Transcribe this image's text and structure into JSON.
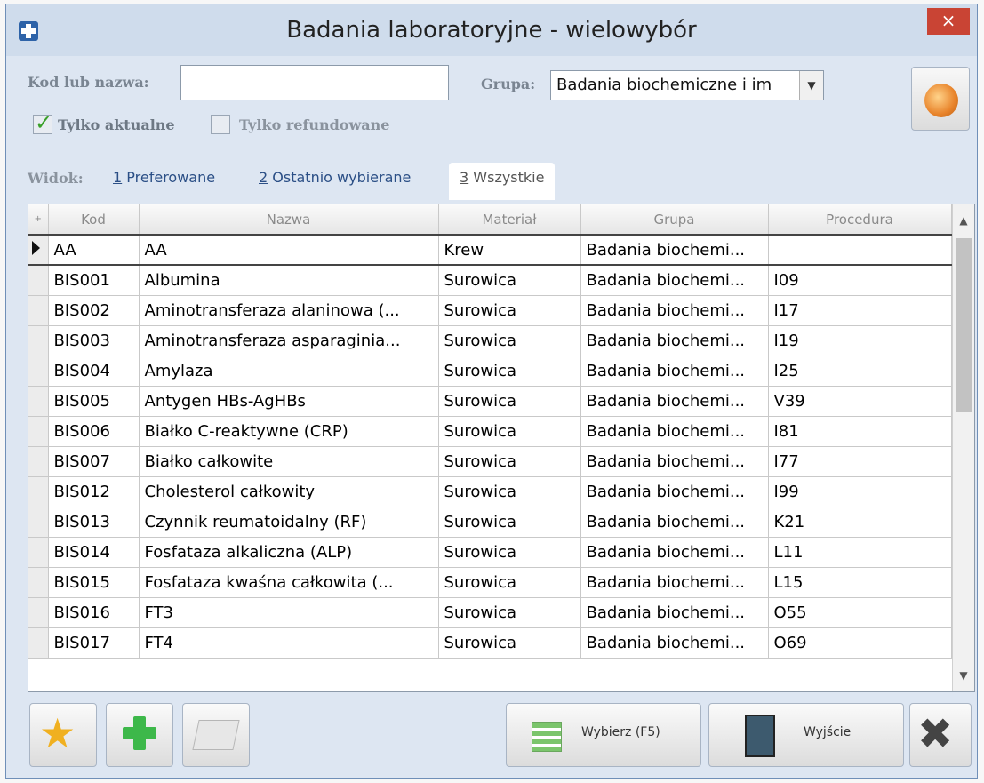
{
  "window": {
    "title": "Badania laboratoryjne - wielowybór",
    "close_glyph": "×"
  },
  "filters": {
    "code_label": "Kod lub nazwa:",
    "code_value": "",
    "group_label": "Grupa:",
    "group_value": "Badania biochemiczne i im",
    "only_current_label": "Tylko aktualne",
    "only_current_checked": true,
    "only_refunded_label": "Tylko refundowane",
    "only_refunded_checked": false
  },
  "view": {
    "label": "Widok:",
    "tabs": [
      {
        "key": "1",
        "label": "Preferowane",
        "active": false
      },
      {
        "key": "2",
        "label": "Ostatnio wybierane",
        "active": false
      },
      {
        "key": "3",
        "label": "Wszystkie",
        "active": true
      }
    ]
  },
  "grid": {
    "columns": [
      "Kod",
      "Nazwa",
      "Materiał",
      "Grupa",
      "Procedura"
    ],
    "rows": [
      {
        "kod": "AA",
        "nazwa": "AA",
        "material": "Krew",
        "grupa": "Badania biochemi...",
        "procedura": "",
        "selected": true
      },
      {
        "kod": "BIS001",
        "nazwa": "Albumina",
        "material": "Surowica",
        "grupa": "Badania biochemi...",
        "procedura": "I09"
      },
      {
        "kod": "BIS002",
        "nazwa": "Aminotransferaza alaninowa (...",
        "material": "Surowica",
        "grupa": "Badania biochemi...",
        "procedura": "I17"
      },
      {
        "kod": "BIS003",
        "nazwa": "Aminotransferaza asparaginia...",
        "material": "Surowica",
        "grupa": "Badania biochemi...",
        "procedura": "I19"
      },
      {
        "kod": "BIS004",
        "nazwa": "Amylaza",
        "material": "Surowica",
        "grupa": "Badania biochemi...",
        "procedura": "I25"
      },
      {
        "kod": "BIS005",
        "nazwa": "Antygen HBs-AgHBs",
        "material": "Surowica",
        "grupa": "Badania biochemi...",
        "procedura": "V39"
      },
      {
        "kod": "BIS006",
        "nazwa": "Białko C-reaktywne (CRP)",
        "material": "Surowica",
        "grupa": "Badania biochemi...",
        "procedura": "I81"
      },
      {
        "kod": "BIS007",
        "nazwa": "Białko całkowite",
        "material": "Surowica",
        "grupa": "Badania biochemi...",
        "procedura": "I77"
      },
      {
        "kod": "BIS012",
        "nazwa": "Cholesterol całkowity",
        "material": "Surowica",
        "grupa": "Badania biochemi...",
        "procedura": "I99"
      },
      {
        "kod": "BIS013",
        "nazwa": "Czynnik reumatoidalny (RF)",
        "material": "Surowica",
        "grupa": "Badania biochemi...",
        "procedura": "K21"
      },
      {
        "kod": "BIS014",
        "nazwa": "Fosfataza alkaliczna (ALP)",
        "material": "Surowica",
        "grupa": "Badania biochemi...",
        "procedura": "L11"
      },
      {
        "kod": "BIS015",
        "nazwa": "Fosfataza kwaśna całkowita (...",
        "material": "Surowica",
        "grupa": "Badania biochemi...",
        "procedura": "L15"
      },
      {
        "kod": "BIS016",
        "nazwa": "FT3",
        "material": "Surowica",
        "grupa": "Badania biochemi...",
        "procedura": "O55"
      },
      {
        "kod": "BIS017",
        "nazwa": "FT4",
        "material": "Surowica",
        "grupa": "Badania biochemi...",
        "procedura": "O69"
      }
    ]
  },
  "buttons": {
    "select_label": "Wybierz (F5)",
    "exit_label": "Wyjście"
  },
  "icons": {
    "app": "medical-cross-icon",
    "favorite": "star-icon",
    "add": "plus-icon",
    "edit": "edit-icon",
    "select": "list-select-icon",
    "exit": "door-exit-icon",
    "settings": "tools-icon",
    "refresh": "orange-orb-icon"
  }
}
